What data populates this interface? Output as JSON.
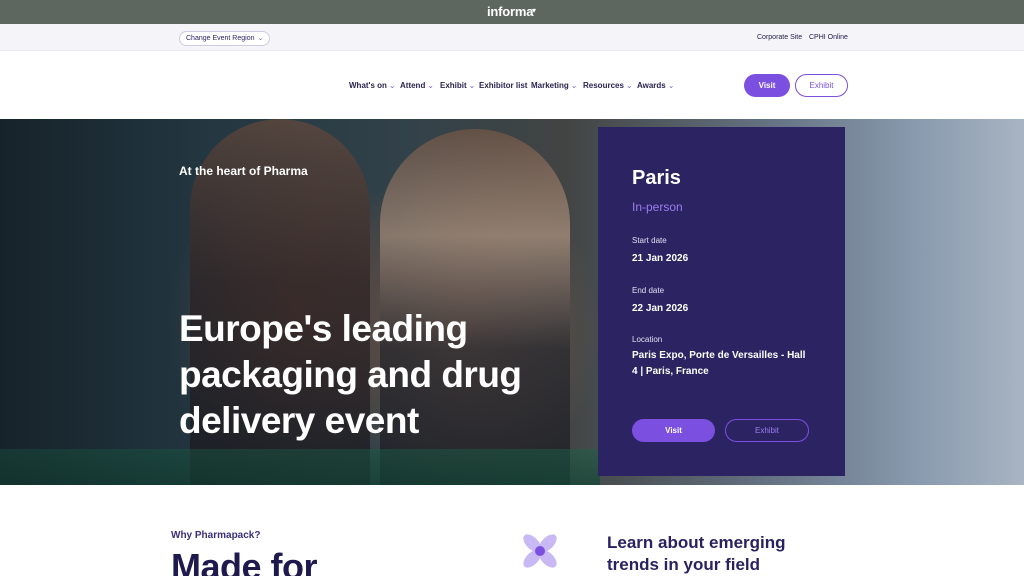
{
  "topbar": {
    "brand": "informa",
    "brand_caret": "▾"
  },
  "utility": {
    "region_button": "Change Event Region",
    "links": [
      "Corporate Site",
      "CPHI Online"
    ]
  },
  "nav": {
    "items": [
      {
        "label": "What's on",
        "has_dropdown": true
      },
      {
        "label": "Attend",
        "has_dropdown": true
      },
      {
        "label": "Exhibit",
        "has_dropdown": true
      },
      {
        "label": "Exhibitor list",
        "has_dropdown": false
      },
      {
        "label": "Marketing",
        "has_dropdown": true
      },
      {
        "label": "Resources",
        "has_dropdown": true
      },
      {
        "label": "Awards",
        "has_dropdown": true
      }
    ],
    "visit_button": "Visit",
    "exhibit_button": "Exhibit"
  },
  "hero": {
    "tagline": "At the heart of Pharma",
    "headline": "Europe's leading packaging and drug delivery event"
  },
  "event_card": {
    "city": "Paris",
    "format": "In-person",
    "start_label": "Start date",
    "start_value": "21 Jan 2026",
    "end_label": "End date",
    "end_value": "22 Jan 2026",
    "location_label": "Location",
    "location_value": "Paris Expo, Porte de Versailles - Hall 4 | Paris, France",
    "visit_button": "Visit",
    "exhibit_button": "Exhibit"
  },
  "below": {
    "why_label": "Why Pharmapack?",
    "made_for": "Made for",
    "learn_heading": "Learn about emerging trends in your field"
  },
  "colors": {
    "accent": "#7b4fe0",
    "card_bg": "#2c2462",
    "topbar_bg": "#5e6660",
    "heading": "#2a2260"
  }
}
